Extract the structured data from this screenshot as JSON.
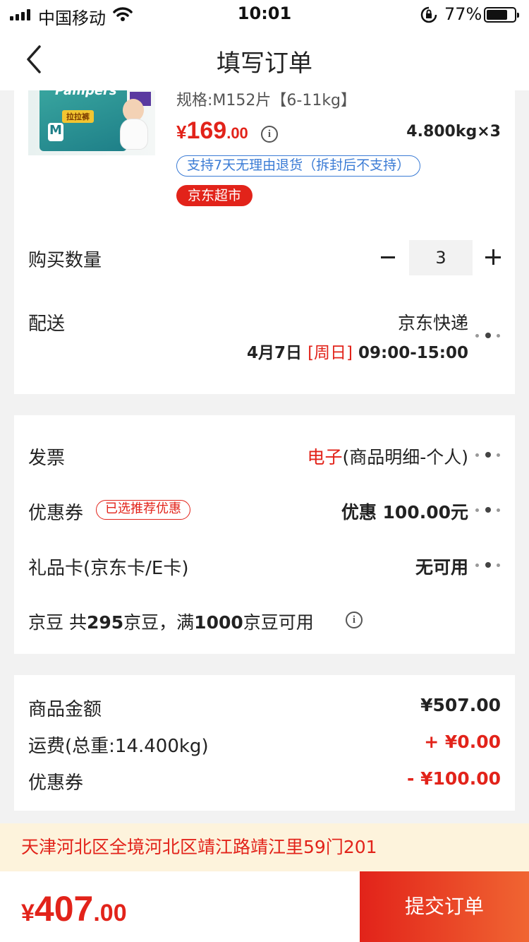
{
  "status_bar": {
    "carrier": "中国移动",
    "time": "10:01",
    "battery_percent": "77%",
    "battery_level": 0.77
  },
  "nav": {
    "title": "填写订单"
  },
  "product": {
    "brand_logo": "Pampers",
    "package_badge": "拉拉裤",
    "package_size": "M",
    "spec": "规格:M152片【6-11kg】",
    "price_currency": "¥",
    "price_int": "169",
    "price_dec": ".00",
    "weight": "4.800kg×3",
    "return_policy": "支持7天无理由退货（拆封后不支持）",
    "shop_tag": "京东超市"
  },
  "quantity": {
    "label": "购买数量",
    "value": "3"
  },
  "shipping": {
    "label": "配送",
    "method": "京东快递",
    "date": "4月7日 ",
    "day": "[周日]",
    "time": " 09:00-15:00"
  },
  "invoice": {
    "label": "发票",
    "type": "电子",
    "detail": "(商品明细-个人)"
  },
  "coupon": {
    "label": "优惠券",
    "tag": "已选推荐优惠",
    "value": "优惠 100.00元"
  },
  "gift_card": {
    "label": "礼品卡(京东卡/E卡)",
    "value": "无可用"
  },
  "beans": {
    "label": "京豆",
    "text1": "  共",
    "count": "295",
    "text2": "京豆，满",
    "threshold": "1000",
    "text3": "京豆可用"
  },
  "summary": {
    "items_label": "商品金额",
    "items_value": "¥507.00",
    "freight_label": "运费(总重:14.400kg)",
    "freight_value": "+ ¥0.00",
    "coupon_label": "优惠券",
    "coupon_value": "- ¥100.00"
  },
  "address": "天津河北区全境河北区靖江路靖江里59门201",
  "footer": {
    "total_currency": "¥",
    "total_int": "407",
    "total_dec": ".00",
    "submit_label": "提交订单"
  },
  "colors": {
    "accent": "#e2231a",
    "link_blue": "#3a7bd5",
    "address_bg": "#fdf3dc"
  },
  "icons": [
    "cellular-signal-icon",
    "wifi-icon",
    "rotation-lock-icon",
    "battery-icon",
    "back-arrow-icon",
    "info-icon",
    "more-dots-icon",
    "minus-icon",
    "plus-icon"
  ]
}
